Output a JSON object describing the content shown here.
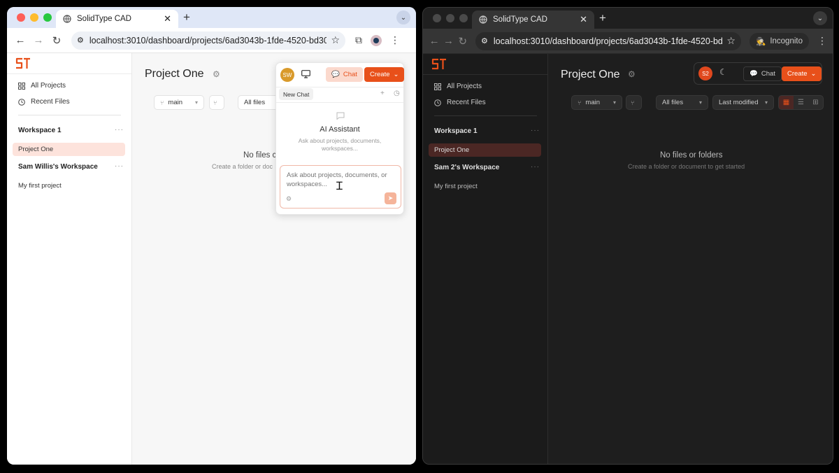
{
  "left_window": {
    "tab_title": "SolidType CAD",
    "url": "localhost:3010/dashboard/projects/6ad3043b-1fde-4520-bd30-...",
    "sidebar": {
      "nav": [
        {
          "label": "All Projects",
          "icon": "grid-icon"
        },
        {
          "label": "Recent Files",
          "icon": "clock-icon"
        }
      ],
      "workspaces": [
        {
          "name": "Workspace 1",
          "projects": [
            "Project One"
          ]
        },
        {
          "name": "Sam Willis's Workspace",
          "projects": [
            "My first project"
          ]
        }
      ]
    },
    "main": {
      "title": "Project One",
      "branch": "main",
      "filter": "All files",
      "empty_title": "No files c",
      "empty_sub": "Create a folder or doc"
    },
    "header": {
      "avatar": "SW",
      "chat_label": "Chat",
      "create_label": "Create"
    },
    "chat_panel": {
      "tab_label": "New Chat",
      "title": "AI Assistant",
      "subtitle": "Ask about projects, documents, workspaces...",
      "input_placeholder": "Ask about projects, documents, or workspaces..."
    }
  },
  "right_window": {
    "tab_title": "SolidType CAD",
    "url": "localhost:3010/dashboard/projects/6ad3043b-1fde-4520-bd3...",
    "incognito_label": "Incognito",
    "sidebar": {
      "nav": [
        {
          "label": "All Projects",
          "icon": "grid-icon"
        },
        {
          "label": "Recent Files",
          "icon": "clock-icon"
        }
      ],
      "workspaces": [
        {
          "name": "Workspace 1",
          "projects": [
            "Project One"
          ]
        },
        {
          "name": "Sam 2's Workspace",
          "projects": [
            "My first project"
          ]
        }
      ]
    },
    "main": {
      "title": "Project One",
      "branch": "main",
      "filter": "All files",
      "sort": "Last modified",
      "empty_title": "No files or folders",
      "empty_sub": "Create a folder or document to get started"
    },
    "header": {
      "avatar": "S2",
      "chat_label": "Chat",
      "create_label": "Create"
    }
  },
  "colors": {
    "accent": "#e8501a",
    "accent_light": "#f5b49a",
    "active_item_light": "#fde3dc",
    "active_item_dark": "#4b2724",
    "avatar_sw": "#d99a2b",
    "avatar_s2": "#e0481e"
  }
}
